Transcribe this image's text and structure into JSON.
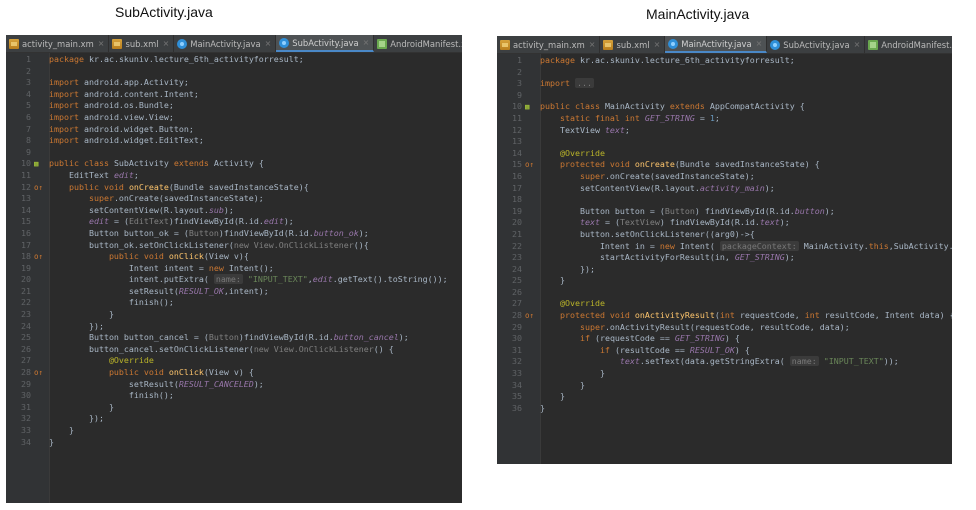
{
  "titles": {
    "left": "SubActivity.java",
    "right": "MainActivity.java"
  },
  "left_tabs": [
    {
      "label": "activity_main.xm",
      "icon": "xml-file-icon",
      "active": false
    },
    {
      "label": "sub.xml",
      "icon": "xml-file-icon",
      "active": false
    },
    {
      "label": "MainActivity.java",
      "icon": "java-class-icon",
      "active": false
    },
    {
      "label": "SubActivity.java",
      "icon": "java-class-icon",
      "active": true
    },
    {
      "label": "AndroidManifest.xml",
      "icon": "manifest-file-icon",
      "active": false
    }
  ],
  "right_tabs": [
    {
      "label": "activity_main.xm",
      "icon": "xml-file-icon",
      "active": false
    },
    {
      "label": "sub.xml",
      "icon": "xml-file-icon",
      "active": false
    },
    {
      "label": "MainActivity.java",
      "icon": "java-class-icon",
      "active": true
    },
    {
      "label": "SubActivity.java",
      "icon": "java-class-icon",
      "active": false
    },
    {
      "label": "AndroidManifest.xml",
      "icon": "manifest-file-icon",
      "active": false
    }
  ],
  "left_code": [
    {
      "n": "1",
      "m": "",
      "t": [
        [
          "kw",
          "package "
        ],
        [
          "",
          "kr.ac.skuniv.lecture_6th_activityforresult;"
        ]
      ]
    },
    {
      "n": "2",
      "m": "",
      "t": []
    },
    {
      "n": "3",
      "m": "",
      "t": [
        [
          "kw",
          "import "
        ],
        [
          "",
          "android.app.Activity;"
        ]
      ]
    },
    {
      "n": "4",
      "m": "",
      "t": [
        [
          "kw",
          "import "
        ],
        [
          "",
          "android.content.Intent;"
        ]
      ]
    },
    {
      "n": "5",
      "m": "",
      "t": [
        [
          "kw",
          "import "
        ],
        [
          "",
          "android.os.Bundle;"
        ]
      ]
    },
    {
      "n": "6",
      "m": "",
      "t": [
        [
          "kw",
          "import "
        ],
        [
          "",
          "android.view.View;"
        ]
      ]
    },
    {
      "n": "7",
      "m": "",
      "t": [
        [
          "kw",
          "import "
        ],
        [
          "",
          "android.widget.Button;"
        ]
      ]
    },
    {
      "n": "8",
      "m": "",
      "t": [
        [
          "kw",
          "import "
        ],
        [
          "",
          "android.widget.EditText;"
        ]
      ]
    },
    {
      "n": "9",
      "m": "",
      "t": []
    },
    {
      "n": "10",
      "m": "a",
      "t": [
        [
          "kw",
          "public class "
        ],
        [
          "",
          "SubActivity "
        ],
        [
          "kw",
          "extends "
        ],
        [
          "",
          "Activity {"
        ]
      ]
    },
    {
      "n": "11",
      "m": "",
      "t": [
        [
          "",
          "    EditText "
        ],
        [
          "fld",
          "edit"
        ],
        [
          "",
          ";"
        ]
      ]
    },
    {
      "n": "12",
      "m": "o",
      "t": [
        [
          "kw",
          "    public void "
        ],
        [
          "fn",
          "onCreate"
        ],
        [
          "",
          "(Bundle savedInstanceState){"
        ]
      ]
    },
    {
      "n": "13",
      "m": "",
      "t": [
        [
          "kw",
          "        super"
        ],
        [
          "",
          ".onCreate(savedInstanceState);"
        ]
      ]
    },
    {
      "n": "14",
      "m": "",
      "t": [
        [
          "",
          "        setContentView(R.layout."
        ],
        [
          "fld",
          "sub"
        ],
        [
          "",
          ");"
        ]
      ]
    },
    {
      "n": "15",
      "m": "",
      "t": [
        [
          "fld",
          "        edit"
        ],
        [
          "",
          " = ("
        ],
        [
          "cmt",
          "EditText"
        ],
        [
          "",
          ")findViewById(R.id."
        ],
        [
          "fld",
          "edit"
        ],
        [
          "",
          ");"
        ]
      ]
    },
    {
      "n": "16",
      "m": "",
      "t": [
        [
          "",
          "        Button button_ok = ("
        ],
        [
          "cmt",
          "Button"
        ],
        [
          "",
          ")findViewById(R.id."
        ],
        [
          "fld",
          "button_ok"
        ],
        [
          "",
          ");"
        ]
      ]
    },
    {
      "n": "17",
      "m": "",
      "t": [
        [
          "",
          "        button_ok.setOnClickListener("
        ],
        [
          "cmt",
          "new View.OnClickListener"
        ],
        [
          "",
          "(){"
        ]
      ]
    },
    {
      "n": "18",
      "m": "o",
      "t": [
        [
          "kw",
          "            public void "
        ],
        [
          "fn",
          "onClick"
        ],
        [
          "",
          "(View v){"
        ]
      ]
    },
    {
      "n": "19",
      "m": "",
      "t": [
        [
          "",
          "                Intent intent = "
        ],
        [
          "kw",
          "new "
        ],
        [
          "",
          "Intent();"
        ]
      ]
    },
    {
      "n": "20",
      "m": "",
      "t": [
        [
          "",
          "                intent.putExtra( "
        ],
        [
          "hint",
          "name:"
        ],
        [
          "",
          " "
        ],
        [
          "str",
          "\"INPUT_TEXT\""
        ],
        [
          "",
          ","
        ],
        [
          "fld",
          "edit"
        ],
        [
          "",
          ".getText().toString());"
        ]
      ]
    },
    {
      "n": "21",
      "m": "",
      "t": [
        [
          "",
          "                setResult("
        ],
        [
          "fld",
          "RESULT_OK"
        ],
        [
          "",
          ",intent);"
        ]
      ]
    },
    {
      "n": "22",
      "m": "",
      "t": [
        [
          "",
          "                finish();"
        ]
      ]
    },
    {
      "n": "23",
      "m": "",
      "t": [
        [
          "",
          "            }"
        ]
      ]
    },
    {
      "n": "24",
      "m": "",
      "t": [
        [
          "",
          "        });"
        ]
      ]
    },
    {
      "n": "25",
      "m": "",
      "t": [
        [
          "",
          "        Button button_cancel = ("
        ],
        [
          "cmt",
          "Button"
        ],
        [
          "",
          ")findViewById(R.id."
        ],
        [
          "fld",
          "button_cancel"
        ],
        [
          "",
          ");"
        ]
      ]
    },
    {
      "n": "26",
      "m": "",
      "t": [
        [
          "",
          "        button_cancel.setOnClickListener("
        ],
        [
          "cmt",
          "new View.OnClickListener"
        ],
        [
          "",
          "() {"
        ]
      ]
    },
    {
      "n": "27",
      "m": "",
      "t": [
        [
          "ann",
          "            @Override"
        ]
      ]
    },
    {
      "n": "28",
      "m": "o",
      "t": [
        [
          "kw",
          "            public void "
        ],
        [
          "fn",
          "onClick"
        ],
        [
          "",
          "(View v) {"
        ]
      ]
    },
    {
      "n": "29",
      "m": "",
      "t": [
        [
          "",
          "                setResult("
        ],
        [
          "fld",
          "RESULT_CANCELED"
        ],
        [
          "",
          ");"
        ]
      ]
    },
    {
      "n": "30",
      "m": "",
      "t": [
        [
          "",
          "                finish();"
        ]
      ]
    },
    {
      "n": "31",
      "m": "",
      "t": [
        [
          "",
          "            }"
        ]
      ]
    },
    {
      "n": "32",
      "m": "",
      "t": [
        [
          "",
          "        });"
        ]
      ]
    },
    {
      "n": "33",
      "m": "",
      "t": [
        [
          "",
          "    }"
        ]
      ]
    },
    {
      "n": "34",
      "m": "",
      "t": [
        [
          "",
          "}"
        ]
      ]
    }
  ],
  "right_code": [
    {
      "n": "1",
      "m": "",
      "t": [
        [
          "kw",
          "package "
        ],
        [
          "",
          "kr.ac.skuniv.lecture_6th_activityforresult;"
        ]
      ]
    },
    {
      "n": "2",
      "m": "",
      "t": []
    },
    {
      "n": "3",
      "m": "",
      "t": [
        [
          "kw",
          "import "
        ],
        [
          "hint",
          "..."
        ]
      ]
    },
    {
      "n": "9",
      "m": "",
      "t": []
    },
    {
      "n": "10",
      "m": "a",
      "t": [
        [
          "kw",
          "public class "
        ],
        [
          "",
          "MainActivity "
        ],
        [
          "kw",
          "extends "
        ],
        [
          "",
          "AppCompatActivity {"
        ]
      ]
    },
    {
      "n": "11",
      "m": "",
      "t": [
        [
          "kw",
          "    static final int "
        ],
        [
          "fld",
          "GET_STRING"
        ],
        [
          "",
          " = "
        ],
        [
          "num",
          "1"
        ],
        [
          "",
          ";"
        ]
      ]
    },
    {
      "n": "12",
      "m": "",
      "t": [
        [
          "",
          "    TextView "
        ],
        [
          "fld",
          "text"
        ],
        [
          "",
          ";"
        ]
      ]
    },
    {
      "n": "13",
      "m": "",
      "t": []
    },
    {
      "n": "14",
      "m": "",
      "t": [
        [
          "ann",
          "    @Override"
        ]
      ]
    },
    {
      "n": "15",
      "m": "o",
      "t": [
        [
          "kw",
          "    protected void "
        ],
        [
          "fn",
          "onCreate"
        ],
        [
          "",
          "(Bundle savedInstanceState) {"
        ]
      ]
    },
    {
      "n": "16",
      "m": "",
      "t": [
        [
          "kw",
          "        super"
        ],
        [
          "",
          ".onCreate(savedInstanceState);"
        ]
      ]
    },
    {
      "n": "17",
      "m": "",
      "t": [
        [
          "",
          "        setContentView(R.layout."
        ],
        [
          "fld",
          "activity_main"
        ],
        [
          "",
          ");"
        ]
      ]
    },
    {
      "n": "18",
      "m": "",
      "t": []
    },
    {
      "n": "19",
      "m": "",
      "t": [
        [
          "",
          "        Button button = ("
        ],
        [
          "cmt",
          "Button"
        ],
        [
          "",
          ") findViewById(R.id."
        ],
        [
          "fld",
          "button"
        ],
        [
          "",
          ");"
        ]
      ]
    },
    {
      "n": "20",
      "m": "",
      "t": [
        [
          "fld",
          "        text"
        ],
        [
          "",
          " = ("
        ],
        [
          "cmt",
          "TextView"
        ],
        [
          "",
          ") findViewById(R.id."
        ],
        [
          "fld",
          "text"
        ],
        [
          "",
          ");"
        ]
      ]
    },
    {
      "n": "21",
      "m": "",
      "t": [
        [
          "",
          "        button.setOnClickListener((arg0)->{"
        ]
      ]
    },
    {
      "n": "22",
      "m": "",
      "t": [
        [
          "",
          "            Intent in = "
        ],
        [
          "kw",
          "new "
        ],
        [
          "",
          "Intent( "
        ],
        [
          "hint",
          "packageContext:"
        ],
        [
          "",
          " MainActivity."
        ],
        [
          "kw",
          "this"
        ],
        [
          "",
          ",SubActivity."
        ],
        [
          "kw",
          "class"
        ],
        [
          "",
          ");"
        ]
      ]
    },
    {
      "n": "23",
      "m": "",
      "t": [
        [
          "",
          "            startActivityForResult(in, "
        ],
        [
          "fld",
          "GET_STRING"
        ],
        [
          "",
          ");"
        ]
      ]
    },
    {
      "n": "24",
      "m": "",
      "t": [
        [
          "",
          "        });"
        ]
      ]
    },
    {
      "n": "25",
      "m": "",
      "t": [
        [
          "",
          "    }"
        ]
      ]
    },
    {
      "n": "26",
      "m": "",
      "t": []
    },
    {
      "n": "27",
      "m": "",
      "t": [
        [
          "ann",
          "    @Override"
        ]
      ]
    },
    {
      "n": "28",
      "m": "o",
      "t": [
        [
          "kw",
          "    protected void "
        ],
        [
          "fn",
          "onActivityResult"
        ],
        [
          "",
          "("
        ],
        [
          "kw",
          "int "
        ],
        [
          "",
          "requestCode, "
        ],
        [
          "kw",
          "int "
        ],
        [
          "",
          "resultCode, Intent data) {"
        ]
      ]
    },
    {
      "n": "29",
      "m": "",
      "t": [
        [
          "kw",
          "        super"
        ],
        [
          "",
          ".onActivityResult(requestCode, resultCode, data);"
        ]
      ]
    },
    {
      "n": "30",
      "m": "",
      "t": [
        [
          "kw",
          "        if "
        ],
        [
          "",
          "(requestCode == "
        ],
        [
          "fld",
          "GET_STRING"
        ],
        [
          "",
          ") {"
        ]
      ]
    },
    {
      "n": "31",
      "m": "",
      "t": [
        [
          "kw",
          "            if "
        ],
        [
          "",
          "(resultCode == "
        ],
        [
          "fld",
          "RESULT_OK"
        ],
        [
          "",
          ") {"
        ]
      ]
    },
    {
      "n": "32",
      "m": "",
      "t": [
        [
          "fld",
          "                text"
        ],
        [
          "",
          ".setText(data.getStringExtra( "
        ],
        [
          "hint",
          "name:"
        ],
        [
          "",
          " "
        ],
        [
          "str",
          "\"INPUT_TEXT\""
        ],
        [
          "",
          "));"
        ]
      ]
    },
    {
      "n": "33",
      "m": "",
      "t": [
        [
          "",
          "            }"
        ]
      ]
    },
    {
      "n": "34",
      "m": "",
      "t": [
        [
          "",
          "        }"
        ]
      ]
    },
    {
      "n": "35",
      "m": "",
      "t": [
        [
          "",
          "    }"
        ]
      ]
    },
    {
      "n": "36",
      "m": "",
      "t": [
        [
          "",
          "}"
        ]
      ]
    }
  ]
}
